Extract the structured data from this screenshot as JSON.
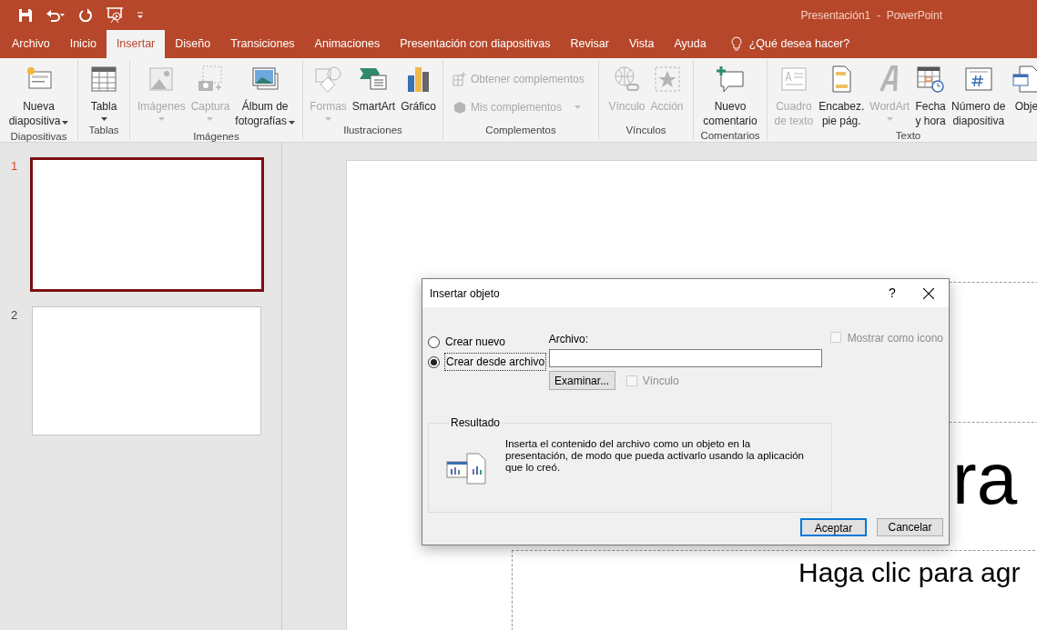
{
  "title_bar": {
    "document_title": "Presentación1  -  PowerPoint"
  },
  "tabs": [
    {
      "label": "Archivo",
      "selected": false
    },
    {
      "label": "Inicio",
      "selected": false
    },
    {
      "label": "Insertar",
      "selected": true
    },
    {
      "label": "Diseño",
      "selected": false
    },
    {
      "label": "Transiciones",
      "selected": false
    },
    {
      "label": "Animaciones",
      "selected": false
    },
    {
      "label": "Presentación con diapositivas",
      "selected": false
    },
    {
      "label": "Revisar",
      "selected": false
    },
    {
      "label": "Vista",
      "selected": false
    },
    {
      "label": "Ayuda",
      "selected": false
    }
  ],
  "tell_me": {
    "label": "¿Qué desea hacer?"
  },
  "ribbon": {
    "groups": [
      {
        "label": "Diapositivas",
        "items": [
          {
            "kind": "menu",
            "label": "Nueva\ndiapositiva",
            "disabled": false
          }
        ]
      },
      {
        "label": "Tablas",
        "items": [
          {
            "kind": "split",
            "label": "Tabla",
            "disabled": false
          }
        ]
      },
      {
        "label": "Imágenes",
        "items": [
          {
            "kind": "split",
            "label": "Imágenes",
            "disabled": true
          },
          {
            "kind": "split",
            "label": "Captura",
            "disabled": true
          },
          {
            "kind": "menu",
            "label": "Álbum de\nfotografías",
            "disabled": false
          }
        ]
      },
      {
        "label": "Ilustraciones",
        "items": [
          {
            "kind": "split",
            "label": "Formas",
            "disabled": true
          },
          {
            "kind": "large",
            "label": "SmartArt",
            "disabled": false
          },
          {
            "kind": "large",
            "label": "Gráfico",
            "disabled": false
          }
        ]
      },
      {
        "label": "Complementos",
        "items": [
          {
            "kind": "small",
            "label": "Obtener complementos",
            "disabled": true
          },
          {
            "kind": "smallmenu",
            "label": "Mis complementos",
            "disabled": true
          }
        ]
      },
      {
        "label": "Vínculos",
        "items": [
          {
            "kind": "large",
            "label": "Vínculo",
            "disabled": true
          },
          {
            "kind": "large",
            "label": "Acción",
            "disabled": true
          }
        ]
      },
      {
        "label": "Comentarios",
        "items": [
          {
            "kind": "large",
            "label": "Nuevo\ncomentario",
            "disabled": false
          }
        ]
      },
      {
        "label": "Texto",
        "items": [
          {
            "kind": "large",
            "label": "Cuadro\nde texto",
            "disabled": true
          },
          {
            "kind": "large",
            "label": "Encabez.\npie pág.",
            "disabled": false
          },
          {
            "kind": "split",
            "label": "WordArt",
            "disabled": true
          },
          {
            "kind": "large",
            "label": "Fecha\ny hora",
            "disabled": false
          },
          {
            "kind": "large",
            "label": "Número de\ndiapositiva",
            "disabled": false
          },
          {
            "kind": "large",
            "label": "Obje",
            "disabled": false
          }
        ]
      }
    ]
  },
  "thumbnails": [
    {
      "number": "1",
      "selected": true
    },
    {
      "number": "2",
      "selected": false
    }
  ],
  "slide": {
    "title": "ra",
    "subtitle": "Haga clic para agr"
  },
  "dialog": {
    "title": "Insertar objeto",
    "help": "?",
    "options": [
      {
        "label": "Crear nuevo",
        "selected": false
      },
      {
        "label": "Crear desde archivo",
        "selected": true
      }
    ],
    "file_label": "Archivo:",
    "browse_button": "Examinar...",
    "link_checkbox": {
      "label": "Vínculo",
      "checked": false,
      "disabled": true
    },
    "icon_checkbox": {
      "label": "Mostrar como icono",
      "checked": false,
      "disabled": true
    },
    "result": {
      "title": "Resultado",
      "text": "Inserta el contenido del archivo como un objeto en la presentación, de modo que pueda activarlo usando la aplicación que lo creó."
    },
    "buttons": [
      {
        "label": "Aceptar",
        "default": true
      },
      {
        "label": "Cancelar",
        "default": false
      }
    ]
  }
}
